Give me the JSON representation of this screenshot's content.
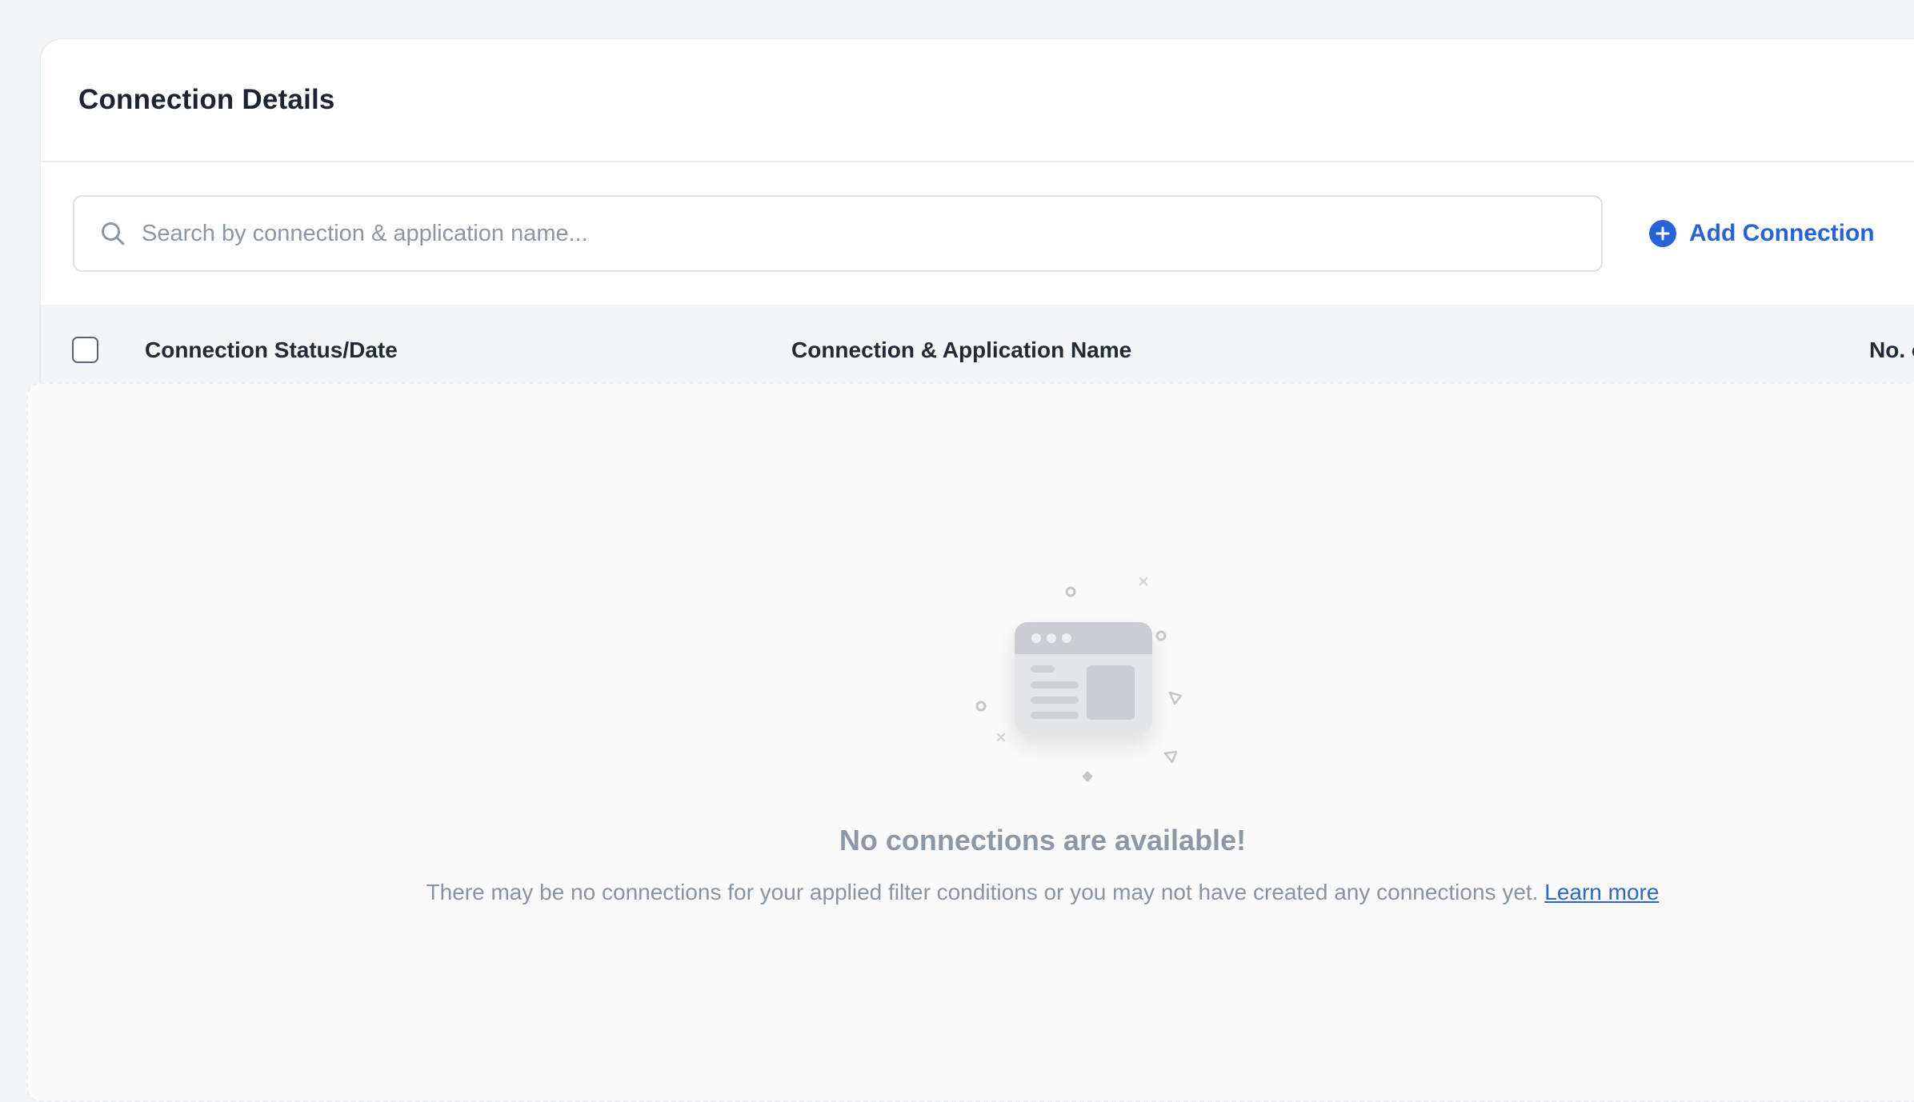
{
  "header": {
    "title": "Connection Details"
  },
  "search": {
    "placeholder": "Search by connection & application name..."
  },
  "toolbar": {
    "add_label": "Add Connection"
  },
  "table": {
    "columns": [
      "Connection Status/Date",
      "Connection & Application Name",
      "No. o"
    ]
  },
  "empty_state": {
    "title": "No connections are available!",
    "description": "There may be no connections for your applied filter conditions or you may not have created any connections yet.",
    "link_label": "Learn more"
  },
  "colors": {
    "accent": "#2563d6",
    "link": "#2c67cf",
    "muted_text": "#8e98a4"
  },
  "icons": [
    "search-icon",
    "plus-circle-icon",
    "empty-browser-illustration"
  ]
}
